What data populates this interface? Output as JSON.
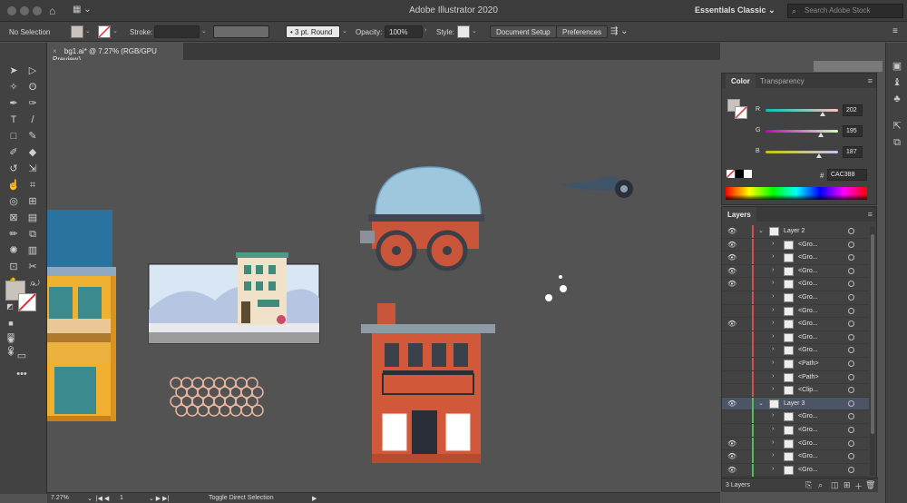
{
  "app": {
    "title": "Adobe Illustrator 2020",
    "workspace": "Essentials Classic",
    "stock_search_placeholder": "Search Adobe Stock"
  },
  "control": {
    "selection": "No Selection",
    "stroke_label": "Stroke:",
    "brush": "3 pt. Round",
    "opacity_label": "Opacity:",
    "opacity_value": "100%",
    "style_label": "Style:",
    "document_setup": "Document Setup",
    "preferences": "Preferences"
  },
  "document": {
    "tab_title": "bg1.ai* @ 7.27% (RGB/GPU Preview)"
  },
  "status": {
    "zoom": "7.27%",
    "artboard": "1",
    "tool_hint": "Toggle Direct Selection"
  },
  "color_panel": {
    "tabs": [
      "Color",
      "Transparency"
    ],
    "r": 202,
    "g": 195,
    "b": 187,
    "r_label": "R",
    "g_label": "G",
    "b_label": "B",
    "hex_label": "#",
    "hex": "CAC388",
    "current_color": "#cac3bb"
  },
  "layers_panel": {
    "title": "Layers",
    "footer": "3 Layers",
    "rows": [
      {
        "name": "Layer 2",
        "visible": true,
        "level": 0,
        "expanded": true
      },
      {
        "name": "<Gro...",
        "visible": true,
        "level": 1
      },
      {
        "name": "<Gro...",
        "visible": true,
        "level": 1
      },
      {
        "name": "<Gro...",
        "visible": true,
        "level": 1
      },
      {
        "name": "<Gro...",
        "visible": true,
        "level": 1
      },
      {
        "name": "<Gro...",
        "visible": false,
        "level": 1
      },
      {
        "name": "<Gro...",
        "visible": false,
        "level": 1
      },
      {
        "name": "<Gro...",
        "visible": true,
        "level": 1
      },
      {
        "name": "<Gro...",
        "visible": false,
        "level": 1
      },
      {
        "name": "<Gro...",
        "visible": false,
        "level": 1
      },
      {
        "name": "<Path>",
        "visible": false,
        "level": 1
      },
      {
        "name": "<Path>",
        "visible": false,
        "level": 1
      },
      {
        "name": "<Clip...",
        "visible": false,
        "level": 1
      },
      {
        "name": "Layer 3",
        "visible": true,
        "level": 0,
        "expanded": true,
        "selected": true
      },
      {
        "name": "<Gro...",
        "visible": false,
        "level": 1
      },
      {
        "name": "<Gro...",
        "visible": false,
        "level": 1
      },
      {
        "name": "<Gro...",
        "visible": true,
        "level": 1
      },
      {
        "name": "<Gro...",
        "visible": true,
        "level": 1
      },
      {
        "name": "<Gro...",
        "visible": true,
        "level": 1
      }
    ]
  },
  "colors": {
    "layer2_bar": "#d34f4f",
    "layer3_bar": "#4fbf5a"
  }
}
